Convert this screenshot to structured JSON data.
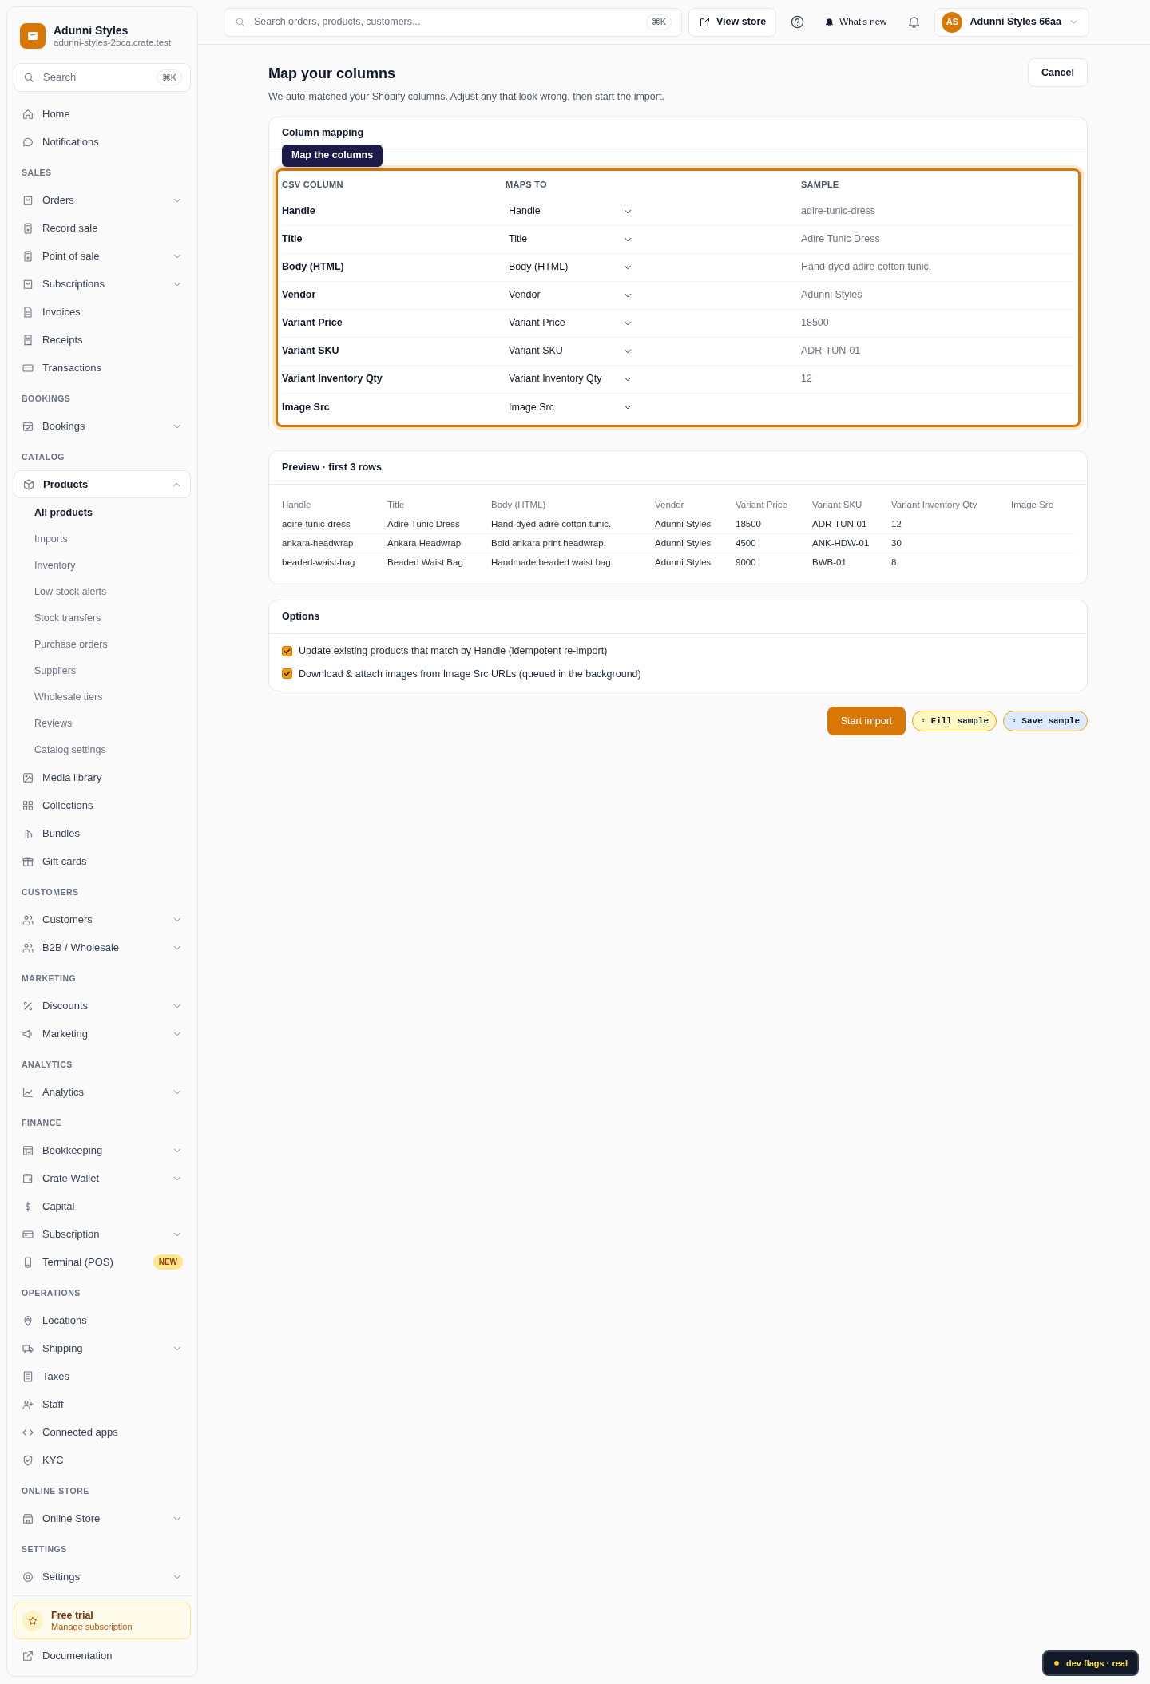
{
  "sidebar": {
    "store_name": "Adunni Styles",
    "store_domain": "adunni-styles-2bca.crate.test",
    "search": {
      "placeholder": "Search",
      "shortcut": "⌘K"
    },
    "sections": [
      {
        "items": [
          {
            "label": "Home",
            "selected": false
          },
          {
            "label": "Notifications",
            "selected": false
          }
        ]
      },
      {
        "heading": "SALES",
        "items": [
          {
            "label": "Orders",
            "selected": false,
            "expanded": false
          },
          {
            "label": "Record sale",
            "selected": false
          },
          {
            "label": "Point of sale",
            "selected": false,
            "expanded": false
          },
          {
            "label": "Subscriptions",
            "selected": false,
            "expanded": false
          },
          {
            "label": "Invoices",
            "selected": false
          },
          {
            "label": "Receipts",
            "selected": false
          },
          {
            "label": "Transactions",
            "selected": false
          }
        ]
      },
      {
        "heading": "BOOKINGS",
        "items": [
          {
            "label": "Bookings",
            "selected": false,
            "expanded": false
          }
        ]
      },
      {
        "heading": "CATALOG",
        "items": [
          {
            "label": "Products",
            "selected": true,
            "expanded": true,
            "children": [
              {
                "label": "All products",
                "selected": true
              },
              {
                "label": "Imports",
                "selected": false
              },
              {
                "label": "Inventory",
                "selected": false
              },
              {
                "label": "Low-stock alerts",
                "selected": false
              },
              {
                "label": "Stock transfers",
                "selected": false
              },
              {
                "label": "Purchase orders",
                "selected": false
              },
              {
                "label": "Suppliers",
                "selected": false
              },
              {
                "label": "Wholesale tiers",
                "selected": false
              },
              {
                "label": "Reviews",
                "selected": false
              },
              {
                "label": "Catalog settings",
                "selected": false
              }
            ]
          },
          {
            "label": "Media library",
            "selected": false
          },
          {
            "label": "Collections",
            "selected": false
          },
          {
            "label": "Bundles",
            "selected": false
          },
          {
            "label": "Gift cards",
            "selected": false
          }
        ]
      },
      {
        "heading": "CUSTOMERS",
        "items": [
          {
            "label": "Customers",
            "selected": false,
            "expanded": false
          },
          {
            "label": "B2B / Wholesale",
            "selected": false,
            "expanded": false
          }
        ]
      },
      {
        "heading": "MARKETING",
        "items": [
          {
            "label": "Discounts",
            "selected": false,
            "expanded": false
          },
          {
            "label": "Marketing",
            "selected": false,
            "expanded": false
          }
        ]
      },
      {
        "heading": "ANALYTICS",
        "items": [
          {
            "label": "Analytics",
            "selected": false,
            "expanded": false
          }
        ]
      },
      {
        "heading": "FINANCE",
        "items": [
          {
            "label": "Bookkeeping",
            "selected": false,
            "expanded": false
          },
          {
            "label": "Crate Wallet",
            "selected": false,
            "expanded": false
          },
          {
            "label": "Capital",
            "selected": false
          },
          {
            "label": "Subscription",
            "selected": false,
            "expanded": false
          },
          {
            "label": "Terminal (POS)",
            "selected": false,
            "badge": "NEW"
          }
        ]
      },
      {
        "heading": "OPERATIONS",
        "items": [
          {
            "label": "Locations",
            "selected": false
          },
          {
            "label": "Shipping",
            "selected": false,
            "expanded": false
          },
          {
            "label": "Taxes",
            "selected": false
          },
          {
            "label": "Staff",
            "selected": false
          },
          {
            "label": "Connected apps",
            "selected": false
          },
          {
            "label": "KYC",
            "selected": false
          }
        ]
      },
      {
        "heading": "ONLINE STORE",
        "items": [
          {
            "label": "Online Store",
            "selected": false,
            "expanded": false
          }
        ]
      },
      {
        "heading": "SETTINGS",
        "items": [
          {
            "label": "Settings",
            "selected": false,
            "expanded": false
          }
        ]
      }
    ],
    "trial": {
      "title": "Free trial",
      "link": "Manage subscription"
    },
    "documentation": "Documentation"
  },
  "topbar": {
    "search": {
      "placeholder": "Search orders, products, customers...",
      "shortcut": "⌘K"
    },
    "view_store": "View store",
    "whats_new": "What's new",
    "account": {
      "initials": "AS",
      "name": "Adunni Styles 66aa"
    }
  },
  "page": {
    "title": "Map your columns",
    "subtitle": "We auto-matched your Shopify columns. Adjust any that look wrong, then start the import.",
    "cancel": "Cancel"
  },
  "mapping": {
    "title": "Column mapping",
    "tooltip": "Map the columns",
    "columns": [
      "CSV COLUMN",
      "MAPS TO",
      "SAMPLE"
    ],
    "rows": [
      {
        "csv": "Handle",
        "maps_to": "Handle",
        "sample": "adire-tunic-dress"
      },
      {
        "csv": "Title",
        "maps_to": "Title",
        "sample": "Adire Tunic Dress"
      },
      {
        "csv": "Body (HTML)",
        "maps_to": "Body (HTML)",
        "sample": "Hand-dyed adire cotton tunic."
      },
      {
        "csv": "Vendor",
        "maps_to": "Vendor",
        "sample": "Adunni Styles"
      },
      {
        "csv": "Variant Price",
        "maps_to": "Variant Price",
        "sample": "18500"
      },
      {
        "csv": "Variant SKU",
        "maps_to": "Variant SKU",
        "sample": "ADR-TUN-01"
      },
      {
        "csv": "Variant Inventory Qty",
        "maps_to": "Variant Inventory Qty",
        "sample": "12"
      },
      {
        "csv": "Image Src",
        "maps_to": "Image Src"
      }
    ]
  },
  "preview": {
    "title": "Preview · first 3 rows",
    "columns": [
      "Handle",
      "Title",
      "Body (HTML)",
      "Vendor",
      "Variant Price",
      "Variant SKU",
      "Variant Inventory Qty",
      "Image Src"
    ],
    "rows": [
      [
        "adire-tunic-dress",
        "Adire Tunic Dress",
        "Hand-dyed adire cotton tunic.",
        "Adunni Styles",
        "18500",
        "ADR-TUN-01",
        "12"
      ],
      [
        "ankara-headwrap",
        "Ankara Headwrap",
        "Bold ankara print headwrap.",
        "Adunni Styles",
        "4500",
        "ANK-HDW-01",
        "30"
      ],
      [
        "beaded-waist-bag",
        "Beaded Waist Bag",
        "Handmade beaded waist bag.",
        "Adunni Styles",
        "9000",
        "BWB-01",
        "8"
      ]
    ]
  },
  "options": {
    "title": "Options",
    "items": [
      {
        "label": "Update existing products that match by Handle (idempotent re-import)",
        "checked": true
      },
      {
        "label": "Download & attach images from Image Src URLs (queued in the background)",
        "checked": true
      }
    ]
  },
  "actions": {
    "start": "Start import",
    "dev_buttons": [
      {
        "label": "▫ Fill sample",
        "kind": "fill"
      },
      {
        "label": "▫ Save sample",
        "kind": "save"
      }
    ]
  },
  "dev_flags": "dev flags · real"
}
